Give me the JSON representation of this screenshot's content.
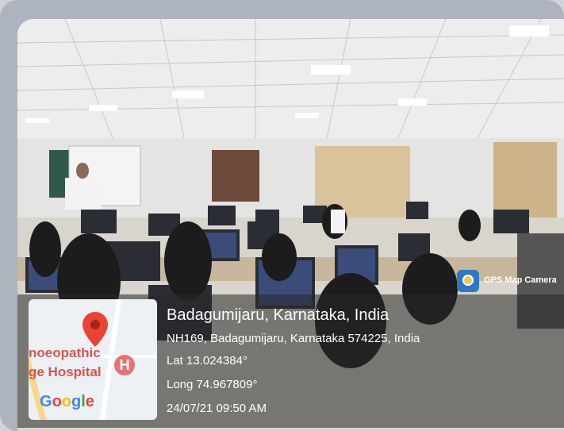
{
  "map_card": {
    "place_line1": "noeopathic",
    "place_line2": "ge Hospital",
    "marker_letter": "H",
    "google_logo": [
      "G",
      "o",
      "o",
      "g",
      "l",
      "e"
    ]
  },
  "badge": {
    "label": "GPS Map Camera"
  },
  "location": {
    "title": "Badagumijaru, Karnataka, India",
    "address": "NH169, Badagumijaru, Karnataka 574225, India",
    "lat": "Lat 13.024384°",
    "long": "Long 74.967809°",
    "datetime": "24/07/21 09:50 AM"
  }
}
